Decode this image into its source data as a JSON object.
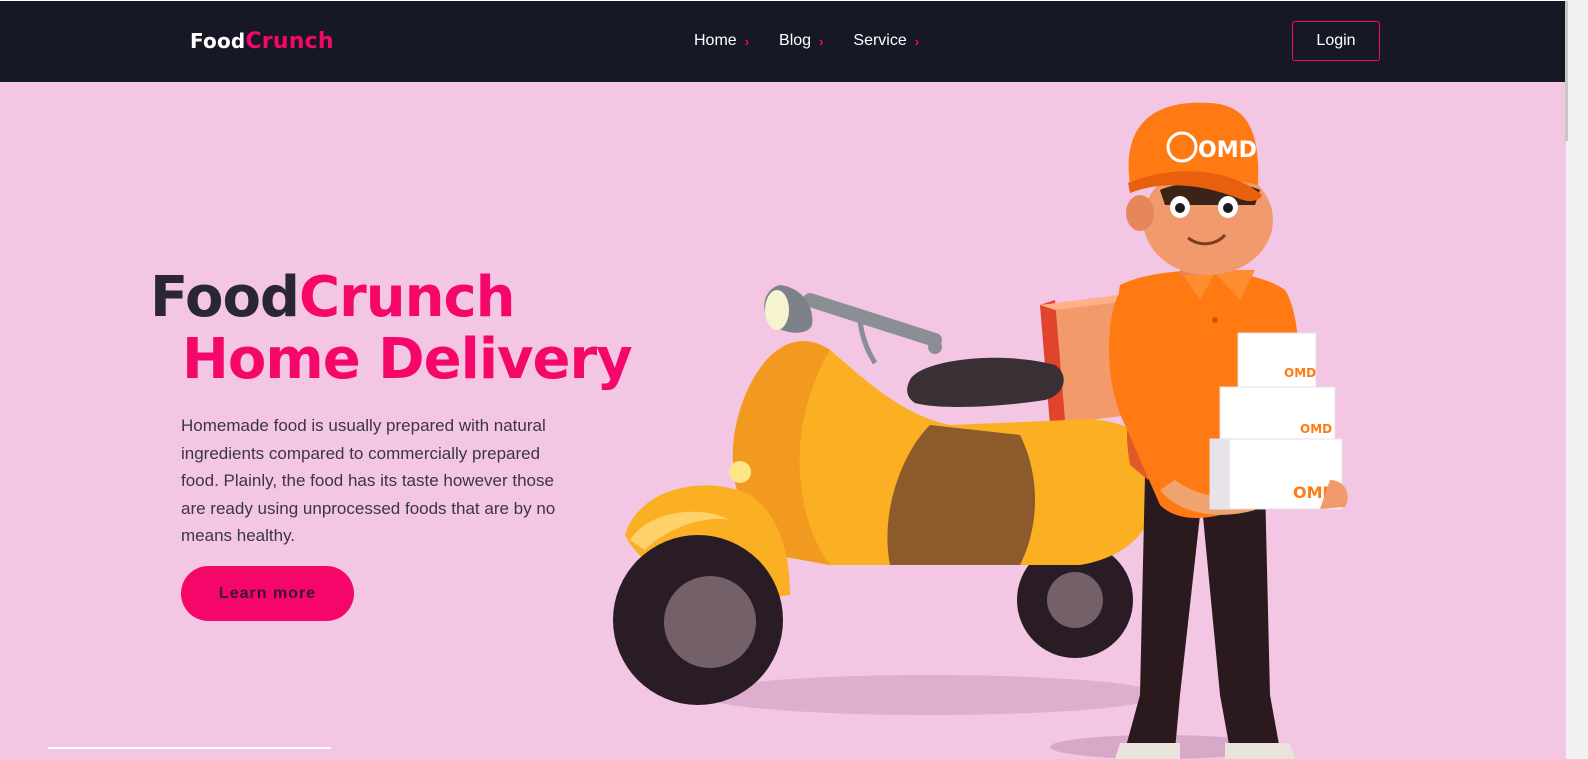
{
  "nav": {
    "logo_part1": "Food",
    "logo_part2": "Crunch",
    "links": [
      {
        "label": "Home",
        "chevron": "›"
      },
      {
        "label": "Blog",
        "chevron": "›"
      },
      {
        "label": "Service",
        "chevron": "›"
      }
    ],
    "login_label": "Login"
  },
  "hero": {
    "title_part1": "Food",
    "title_part2": "Crunch",
    "subtitle": "Home Delivery",
    "description": "Homemade food is usually prepared with natural ingredients compared to commercially prepared food. Plainly, the food has its taste however those are ready using unprocessed foods that are by no means healthy.",
    "cta_label": "Learn more",
    "illustration": {
      "brand_text": "OMD"
    }
  },
  "colors": {
    "accent": "#f5076a",
    "navbar_bg": "#171825",
    "hero_bg": "#f3c6e4",
    "scooter": "#fbb023",
    "uniform": "#ff7a12"
  }
}
